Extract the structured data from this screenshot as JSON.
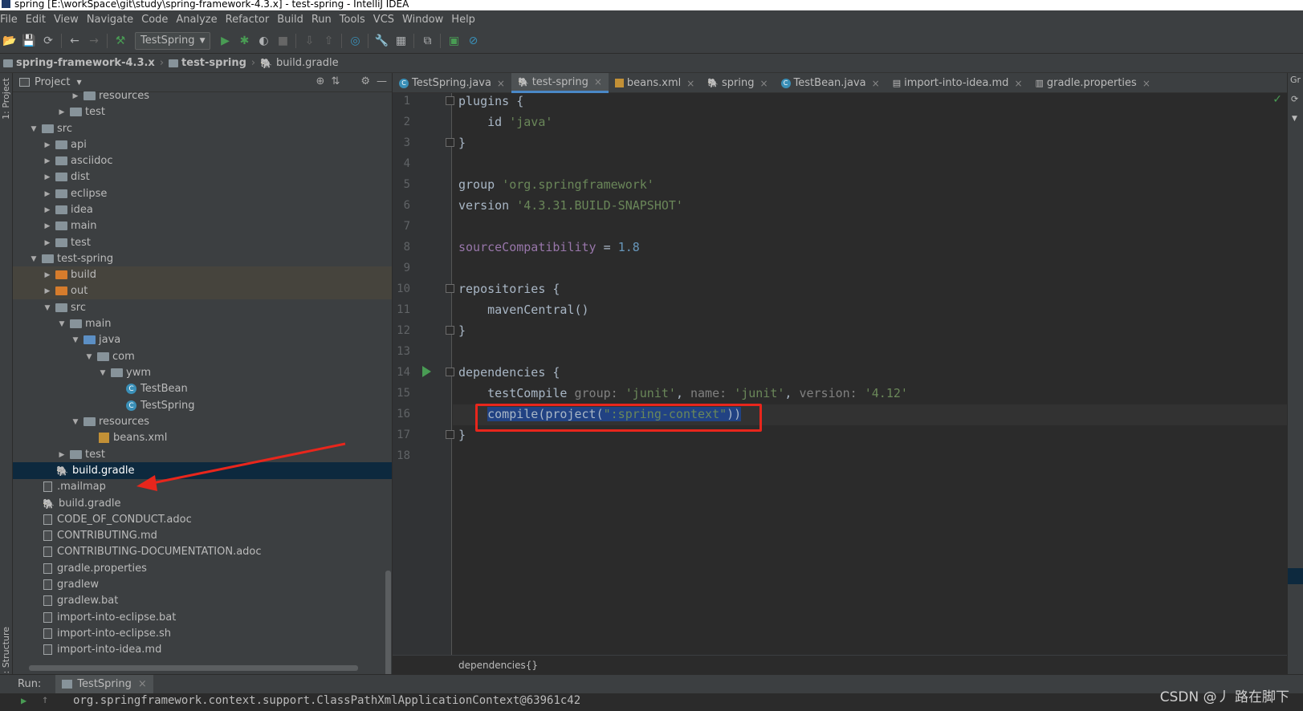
{
  "window": {
    "title": "spring [E:\\workSpace\\git\\study\\spring-framework-4.3.x] - test-spring - IntelliJ IDEA"
  },
  "menu": [
    "File",
    "Edit",
    "View",
    "Navigate",
    "Code",
    "Analyze",
    "Refactor",
    "Build",
    "Run",
    "Tools",
    "VCS",
    "Window",
    "Help"
  ],
  "toolbar": {
    "run_config": "TestSpring"
  },
  "navbar": {
    "crumbs": [
      "spring-framework-4.3.x",
      "test-spring",
      "build.gradle"
    ]
  },
  "left_strip": {
    "project_label": "1: Project",
    "structure_label": "Z: Structure"
  },
  "project": {
    "title": "Project",
    "tree": [
      {
        "label": "resources"
      },
      {
        "label": "test"
      },
      {
        "label": "src"
      },
      {
        "label": "api"
      },
      {
        "label": "asciidoc"
      },
      {
        "label": "dist"
      },
      {
        "label": "eclipse"
      },
      {
        "label": "idea"
      },
      {
        "label": "main"
      },
      {
        "label": "test"
      },
      {
        "label": "test-spring"
      },
      {
        "label": "build"
      },
      {
        "label": "out"
      },
      {
        "label": "src"
      },
      {
        "label": "main"
      },
      {
        "label": "java"
      },
      {
        "label": "com"
      },
      {
        "label": "ywm"
      },
      {
        "label": "TestBean"
      },
      {
        "label": "TestSpring"
      },
      {
        "label": "resources"
      },
      {
        "label": "beans.xml"
      },
      {
        "label": "test"
      },
      {
        "label": "build.gradle"
      },
      {
        "label": ".mailmap"
      },
      {
        "label": "build.gradle"
      },
      {
        "label": "CODE_OF_CONDUCT.adoc"
      },
      {
        "label": "CONTRIBUTING.md"
      },
      {
        "label": "CONTRIBUTING-DOCUMENTATION.adoc"
      },
      {
        "label": "gradle.properties"
      },
      {
        "label": "gradlew"
      },
      {
        "label": "gradlew.bat"
      },
      {
        "label": "import-into-eclipse.bat"
      },
      {
        "label": "import-into-eclipse.sh"
      },
      {
        "label": "import-into-idea.md"
      }
    ]
  },
  "tabs": [
    {
      "label": "TestSpring.java"
    },
    {
      "label": "test-spring"
    },
    {
      "label": "beans.xml"
    },
    {
      "label": "spring"
    },
    {
      "label": "TestBean.java"
    },
    {
      "label": "import-into-idea.md"
    },
    {
      "label": "gradle.properties"
    }
  ],
  "editor": {
    "line_numbers": [
      "1",
      "2",
      "3",
      "4",
      "5",
      "6",
      "7",
      "8",
      "9",
      "10",
      "11",
      "12",
      "13",
      "14",
      "15",
      "16",
      "17",
      "18"
    ],
    "l1": "plugins {",
    "l2_kw": "id ",
    "l2_str": "'java'",
    "l3": "}",
    "l5_kw": "group ",
    "l5_str": "'org.springframework'",
    "l6_kw": "version ",
    "l6_str": "'4.3.31.BUILD-SNAPSHOT'",
    "l8_prop": "sourceCompatibility",
    "l8_eq": " = ",
    "l8_num": "1.8",
    "l10": "repositories {",
    "l11": "mavenCentral()",
    "l12": "}",
    "l14": "dependencies {",
    "l15_a": "testCompile ",
    "l15_n1": "group: ",
    "l15_s1": "'junit'",
    "l15_c1": ", ",
    "l15_n2": "name: ",
    "l15_s2": "'junit'",
    "l15_c2": ", ",
    "l15_n3": "version: ",
    "l15_s3": "'4.12'",
    "l16_a": "compile(project(",
    "l16_s": "\":spring-context\"",
    "l16_b": "))",
    "l17": "}",
    "breadcrumb": "dependencies{}"
  },
  "right_strip": {
    "label": "Gr"
  },
  "run": {
    "label": "Run:",
    "tab": "TestSpring"
  },
  "console": {
    "text": "org.springframework.context.support.ClassPathXmlApplicationContext@63961c42"
  },
  "watermark": "CSDN @丿 路在脚下",
  "colors": {
    "accent": "#4a88c7",
    "highlight_box": "#e8261c",
    "selection": "#214283"
  }
}
